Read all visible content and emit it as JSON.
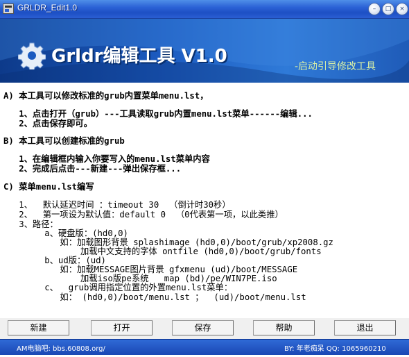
{
  "window": {
    "title": "GRLDR_Edit1.0",
    "buttons": {
      "minimize": "–",
      "maximize": "□",
      "close": "×"
    }
  },
  "banner": {
    "title": "Grldr编辑工具 V1.0",
    "subtitle": "-启动引导修改工具"
  },
  "content": {
    "lines": [
      {
        "text": "A) 本工具可以修改标准的grub内置菜单menu.lst，",
        "style": "bold"
      },
      {
        "text": "   1、点击打开（grub）---工具读取grub内置menu.lst菜单------编辑...",
        "style": "bold"
      },
      {
        "text": "   2、点击保存即可。",
        "style": "bold"
      },
      {
        "text": "B) 本工具可以创建标准的grub",
        "style": "bold"
      },
      {
        "text": "   1、在编辑框内输入你要写入的menu.lst菜单内容",
        "style": "bold"
      },
      {
        "text": "   2、完成后点击---新建---弹出保存框...",
        "style": "bold"
      },
      {
        "text": "C) 菜单menu.lst编写",
        "style": "bold"
      },
      {
        "text": "   1、  默认延迟时间 ：timeout 30  （倒计时30秒）",
        "style": "normal"
      },
      {
        "text": "   2、  第一项设为默认值：default 0  （0代表第一项，以此类推）",
        "style": "normal"
      },
      {
        "text": "   3、路径：",
        "style": "normal"
      },
      {
        "text": "        a、硬盘版：(hd0,0)",
        "style": "normal"
      },
      {
        "text": "           如：加载图形背景 splashimage (hd0,0)/boot/grub/xp2008.gz",
        "style": "normal"
      },
      {
        "text": "               加载中文支持的字体 ontfile (hd0,0)/boot/grub/fonts",
        "style": "normal"
      },
      {
        "text": "        b、ud版：(ud)",
        "style": "normal"
      },
      {
        "text": "           如：加载MESSAGE图片背景 gfxmenu (ud)/boot/MESSAGE",
        "style": "normal"
      },
      {
        "text": "               加载iso版pe系统   map (bd)/pe/WIN7PE.iso",
        "style": "normal"
      },
      {
        "text": "        c、  grub调用指定位置的外置menu.lst菜单：",
        "style": "normal"
      },
      {
        "text": "           如： (hd0,0)/boot/menu.lst ；  (ud)/boot/menu.lst",
        "style": "normal"
      }
    ]
  },
  "toolbar": {
    "new_label": "新建",
    "open_label": "打开",
    "save_label": "保存",
    "help_label": "帮助",
    "exit_label": "退出"
  },
  "status": {
    "left": "AM电脑吧: bbs.60808.org/",
    "right": "BY: 年老痴呆 QQ: 1065960210"
  },
  "colors": {
    "titlebar": "#2b62d6",
    "banner": "#1c5bc0",
    "banner_subtitle": "#d9f0a6",
    "statusbar": "#1a47b4"
  }
}
